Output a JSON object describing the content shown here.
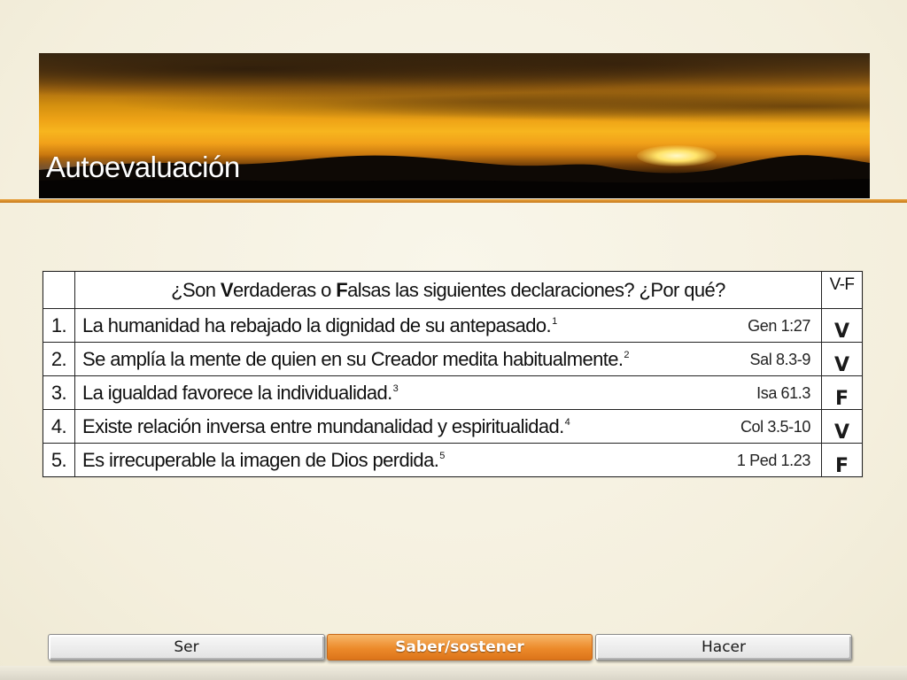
{
  "header": {
    "title": "Autoevaluación"
  },
  "quiz": {
    "question_parts": {
      "p1": "¿Son ",
      "v_initial": "V",
      "p2": "erdaderas o ",
      "f_initial": "F",
      "p3": "alsas las siguientes declaraciones? ¿Por qué?"
    },
    "answer_col_header": "V-F",
    "rows": [
      {
        "num": "1.",
        "text": "La humanidad ha rebajado la dignidad de su antepasado.",
        "note": "1",
        "ref": "Gen 1:27",
        "answer": "V"
      },
      {
        "num": "2.",
        "text": "Se amplía la mente de quien en su Creador medita habitualmente.",
        "note": "2",
        "ref": "Sal 8.3-9",
        "answer": "V"
      },
      {
        "num": "3.",
        "text": "La igualdad favorece la individualidad.",
        "note": "3",
        "ref": "Isa 61.3",
        "answer": "F"
      },
      {
        "num": "4.",
        "text": "Existe relación inversa entre mundanalidad  y espiritualidad.",
        "note": "4",
        "ref": "Col 3.5-10",
        "answer": "V"
      },
      {
        "num": "5.",
        "text": "Es irrecuperable  la imagen de Dios perdida.",
        "note": "5",
        "ref": "1 Ped 1.23",
        "answer": "F"
      }
    ]
  },
  "nav": {
    "tabs": [
      {
        "label": "Ser",
        "active": false
      },
      {
        "label": "Saber/sostener",
        "active": true
      },
      {
        "label": "Hacer",
        "active": false
      }
    ]
  },
  "colors": {
    "accent": "#ec8a2a",
    "banner_rule": "#d98c2a",
    "background": "#f6f2e2"
  }
}
